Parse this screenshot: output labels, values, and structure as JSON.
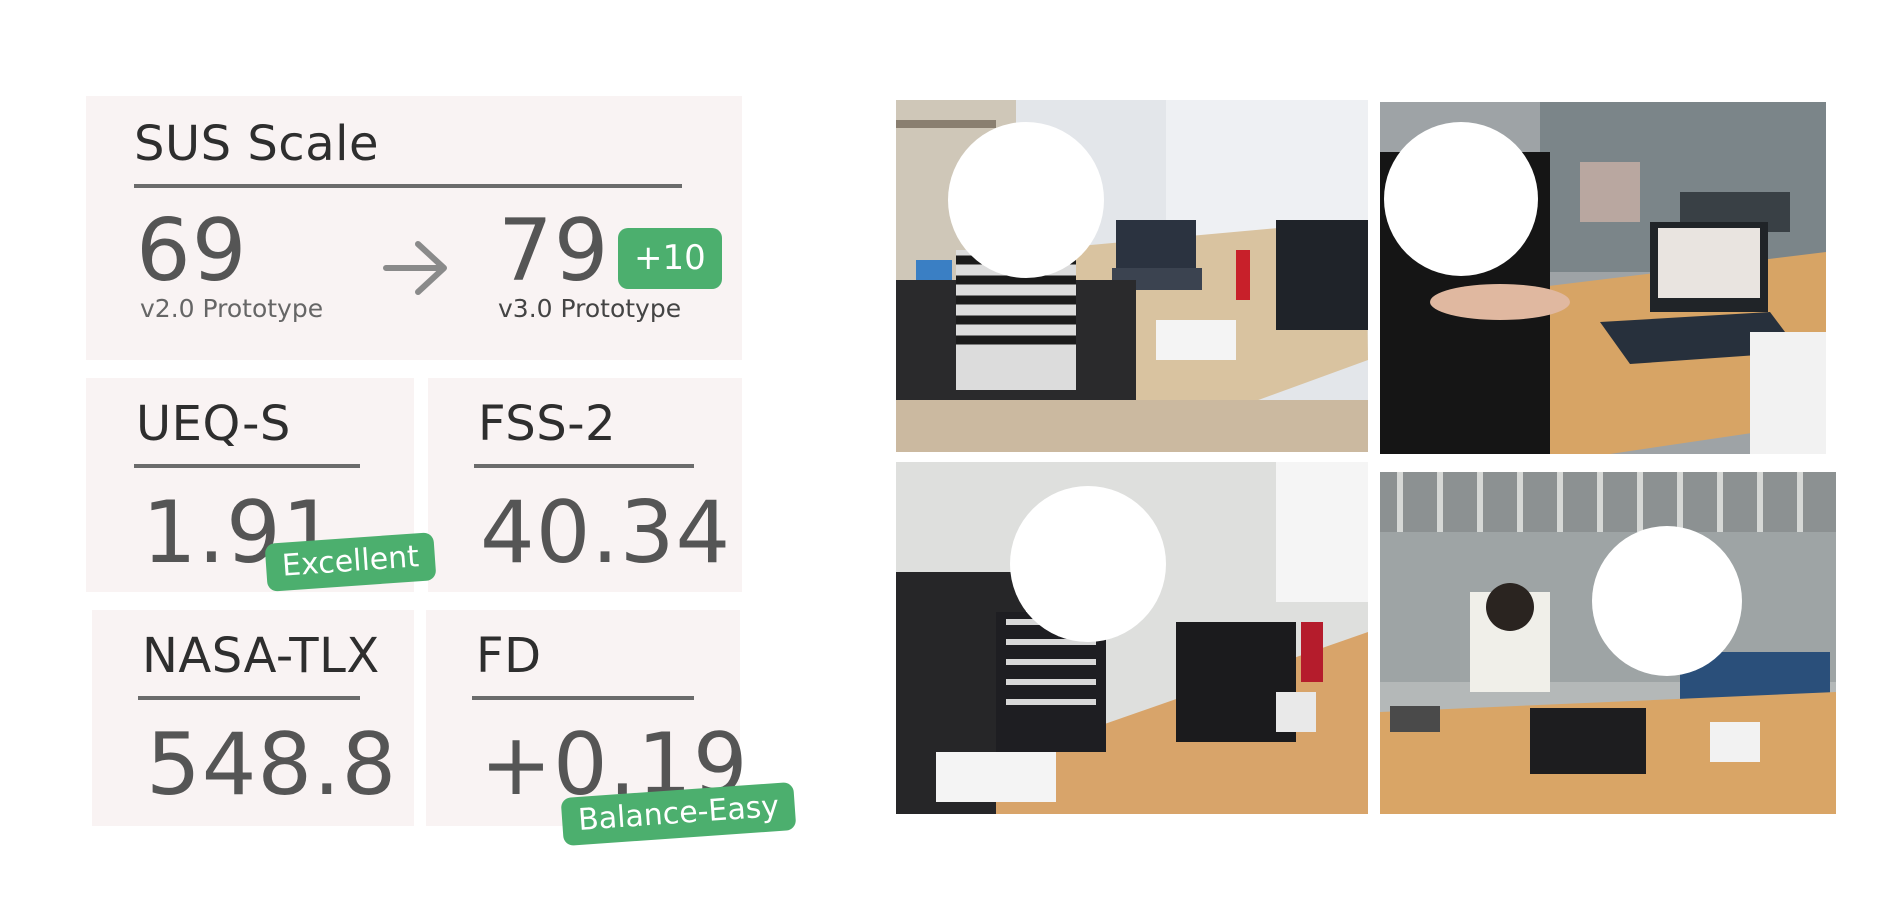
{
  "sus": {
    "title": "SUS Scale",
    "before_value": "69",
    "before_label": "v2.0 Prototype",
    "after_value": "79",
    "after_label": "v3.0 Prototype",
    "delta_badge": "+10"
  },
  "ueq": {
    "title": "UEQ-S",
    "value": "1.91",
    "badge": "Excellent"
  },
  "fss": {
    "title": "FSS-2",
    "value": "40.34"
  },
  "nasa": {
    "title": "NASA-TLX",
    "value": "548.8"
  },
  "fd": {
    "title": "FD",
    "value": "+0.19",
    "badge": "Balance-Easy"
  },
  "colors": {
    "card_bg": "#f9f3f3",
    "badge_green": "#4caf6e",
    "rule": "#6b6b6b"
  },
  "photos": [
    {
      "name": "test-session-photo-1"
    },
    {
      "name": "test-session-photo-2"
    },
    {
      "name": "test-session-photo-3"
    },
    {
      "name": "test-session-photo-4"
    }
  ]
}
